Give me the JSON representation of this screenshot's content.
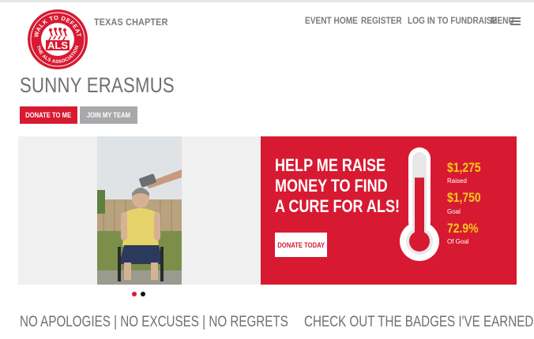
{
  "header": {
    "logo": {
      "top_text": "WALK TO DEFEAT",
      "main_text": "ALS",
      "bottom_text": "THE ALS ASSOCIATION"
    },
    "chapter": "TEXAS CHAPTER",
    "nav": {
      "event_home": "EVENT HOME",
      "register": "REGISTER",
      "login": "LOG IN TO FUNDRAISE",
      "menu": "MENU",
      "menu_icon": "hamburger-icon"
    }
  },
  "profile": {
    "name": "SUNNY ERASMUS",
    "donate_button": "DONATE TO ME",
    "team_button": "JOIN MY TEAM"
  },
  "promo": {
    "headline": [
      "HELP ME RAISE",
      "MONEY TO FIND",
      "A CURE FOR ALS!"
    ],
    "donate_today": "DONATE TODAY",
    "stats": {
      "raised_value": "$1,275",
      "raised_label": "Raised",
      "goal_value": "$1,750",
      "goal_label": "Goal",
      "percent_value": "72.9%",
      "percent_label": "Of Goal"
    },
    "progress_fraction": 0.729
  },
  "carousel": {
    "slide_count": 2,
    "active_slide": 1
  },
  "sections": {
    "tagline": "NO APOLOGIES | NO EXCUSES | NO REGRETS",
    "badges_heading": "CHECK OUT THE BADGES I'VE EARNED"
  },
  "colors": {
    "brand_red": "#d71a32",
    "accent_yellow": "#f6c91a",
    "text_gray": "#6f7072",
    "button_gray": "#a7a9ab"
  }
}
